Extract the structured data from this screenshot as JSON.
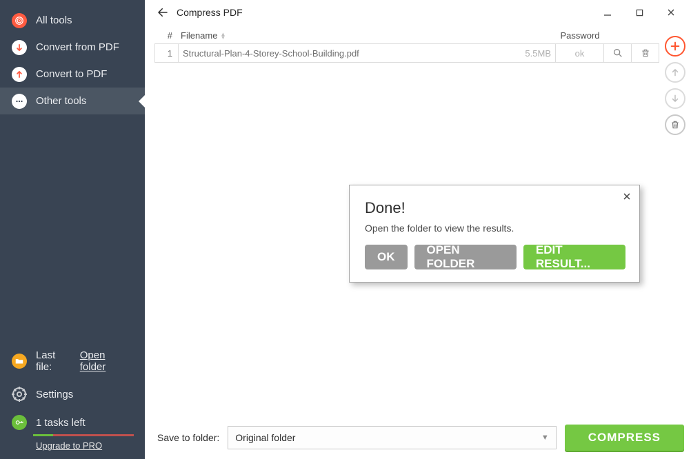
{
  "sidebar": {
    "items": [
      {
        "label": "All tools",
        "icon": "target-icon"
      },
      {
        "label": "Convert from PDF",
        "icon": "arrow-down-icon"
      },
      {
        "label": "Convert to PDF",
        "icon": "arrow-up-icon"
      },
      {
        "label": "Other tools",
        "icon": "dots-icon",
        "active": true
      }
    ],
    "lastfile_label": "Last file:",
    "lastfile_link": "Open folder",
    "settings_label": "Settings",
    "tasks_label": "1 tasks left",
    "upgrade_label": "Upgrade to PRO"
  },
  "header": {
    "title": "Compress PDF"
  },
  "table": {
    "col_index": "#",
    "col_filename": "Filename",
    "col_password": "Password",
    "rows": [
      {
        "index": "1",
        "filename": "Structural-Plan-4-Storey-School-Building.pdf",
        "size": "5.5MB",
        "pwd": "ok"
      }
    ]
  },
  "footer": {
    "save_label": "Save to folder:",
    "save_value": "Original folder",
    "compress_label": "COMPRESS"
  },
  "dialog": {
    "title": "Done!",
    "text": "Open the folder to view the results.",
    "ok": "OK",
    "open_folder": "OPEN FOLDER",
    "edit": "EDIT RESULT..."
  }
}
